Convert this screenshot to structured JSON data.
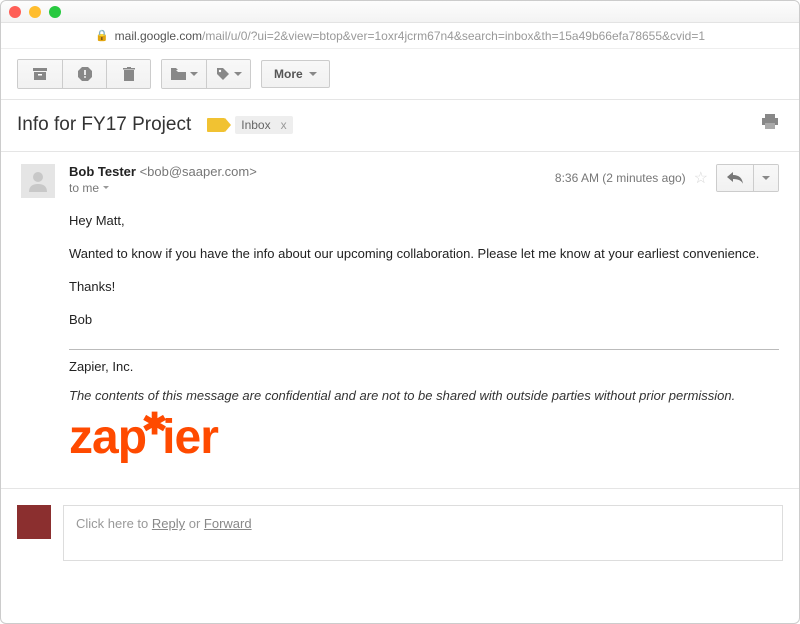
{
  "addressbar": {
    "host": "mail.google.com",
    "path": "/mail/u/0/?ui=2&view=btop&ver=1oxr4jcrm67n4&search=inbox&th=15a49b66efa78655&cvid=1"
  },
  "toolbar": {
    "more_label": "More"
  },
  "subject": "Info for FY17 Project",
  "inbox_chip": "Inbox",
  "sender": {
    "name": "Bob Tester",
    "email": "<bob@saaper.com>"
  },
  "recipient_line": "to me",
  "timestamp": "8:36 AM (2 minutes ago)",
  "body": {
    "greeting": "Hey Matt,",
    "para1": "Wanted to know if you have the info about our upcoming collaboration. Please let me know at your earliest convenience.",
    "thanks": "Thanks!",
    "signoff": "Bob"
  },
  "signature": {
    "company": "Zapier, Inc.",
    "disclaimer": "The contents of this message are confidential and are not to be shared with outside parties without prior permission.",
    "logo_text": "zapier"
  },
  "reply": {
    "prefix": "Click here to ",
    "reply": "Reply",
    "or": " or ",
    "forward": "Forward"
  }
}
